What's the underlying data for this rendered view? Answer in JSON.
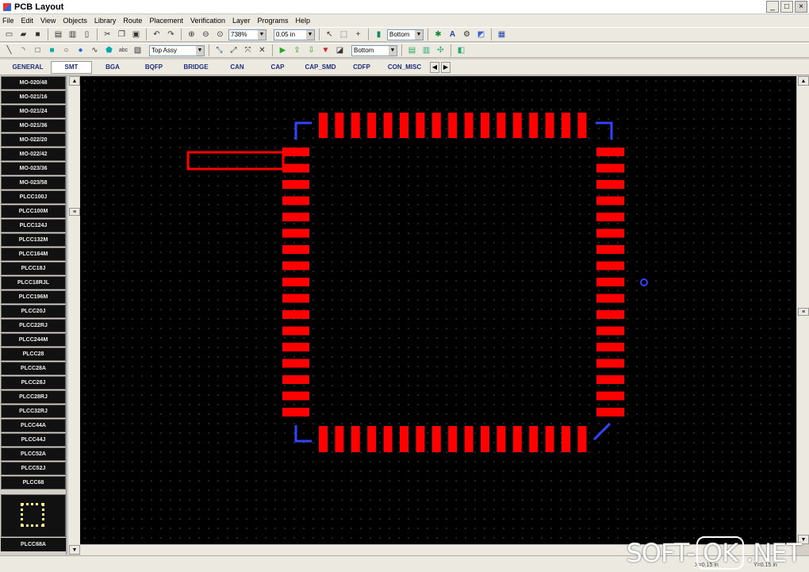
{
  "window": {
    "title": "PCB Layout",
    "minimize": "_",
    "maximize": "□",
    "close": "×"
  },
  "menu": [
    "File",
    "Edit",
    "View",
    "Objects",
    "Library",
    "Route",
    "Placement",
    "Verification",
    "Layer",
    "Programs",
    "Help"
  ],
  "toolbar": {
    "zoom_value": "738%",
    "grid_value": "0.05 in",
    "layer_value": "Bottom",
    "layer2_value": "Top Assy",
    "layer3_value": "Bottom"
  },
  "tabs": [
    "GENERAL",
    "SMT",
    "BGA",
    "BQFP",
    "BRIDGE",
    "CAN",
    "CAP",
    "CAP_SMD",
    "CDFP",
    "CON_MISC"
  ],
  "active_tab": "SMT",
  "packages": [
    "MO-020/48",
    "MO-021/16",
    "MO-021/24",
    "MO-021/36",
    "MO-022/20",
    "MO-022/42",
    "MO-023/36",
    "MO-023/58",
    "PLCC100J",
    "PLCC100M",
    "PLCC124J",
    "PLCC132M",
    "PLCC164M",
    "PLCC18J",
    "PLCC18RJL",
    "PLCC196M",
    "PLCC20J",
    "PLCC22RJ",
    "PLCC244M",
    "PLCC28",
    "PLCC28A",
    "PLCC28J",
    "PLCC28RJ",
    "PLCC32RJ",
    "PLCC44A",
    "PLCC44J",
    "PLCC52A",
    "PLCC52J",
    "PLCC68"
  ],
  "thumb_label": "PLCC68A",
  "status": {
    "coord1": "X=0.15 in",
    "coord2": "Y=0.15 in"
  },
  "watermark": {
    "left": "SOFT-",
    "mid": "OK",
    "right": ".NET"
  },
  "colors": {
    "pad": "#ff0000",
    "outline": "#3344ff",
    "canvas": "#000000"
  }
}
